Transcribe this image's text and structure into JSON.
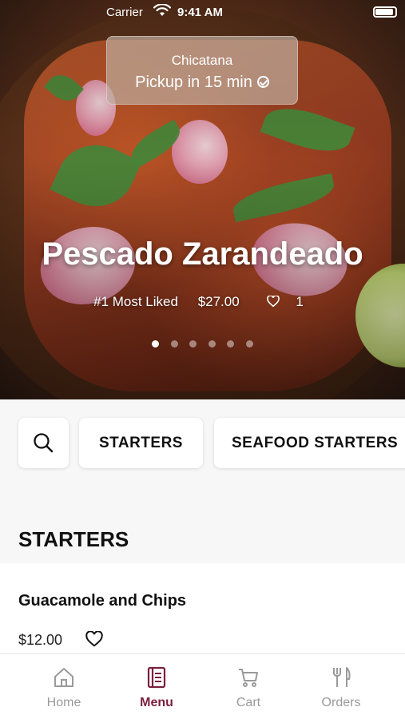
{
  "status_bar": {
    "carrier": "Carrier",
    "time": "9:41 AM"
  },
  "pickup": {
    "location": "Chicatana",
    "label": "Pickup in 15 min"
  },
  "featured": {
    "name": "Pescado Zarandeado",
    "badge": "#1 Most Liked",
    "price": "$27.00",
    "likes": "1",
    "carousel_pages": 6,
    "active_page": 1
  },
  "categories": {
    "search_icon": "search-icon",
    "items": [
      "STARTERS",
      "SEAFOOD STARTERS"
    ]
  },
  "section": {
    "title": "STARTERS"
  },
  "items": [
    {
      "name": "Guacamole and Chips",
      "price": "$12.00",
      "icon": "heart-outline-icon"
    }
  ],
  "tabs": [
    {
      "label": "Home",
      "icon": "home-icon",
      "active": false
    },
    {
      "label": "Menu",
      "icon": "menu-book-icon",
      "active": true
    },
    {
      "label": "Cart",
      "icon": "cart-icon",
      "active": false
    },
    {
      "label": "Orders",
      "icon": "fork-knife-icon",
      "active": false
    }
  ],
  "colors": {
    "accent": "#7a1f3d",
    "inactive": "#9a9a9a",
    "background": "#f7f7f7"
  }
}
